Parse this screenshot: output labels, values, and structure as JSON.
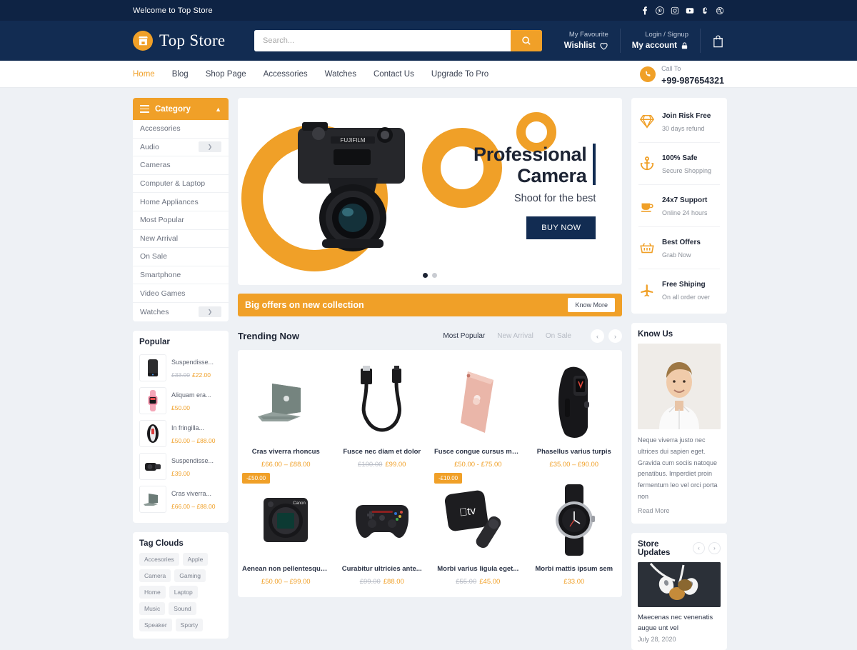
{
  "topbar": {
    "welcome": "Welcome to Top Store",
    "social": [
      {
        "name": "facebook-icon"
      },
      {
        "name": "pinterest-icon"
      },
      {
        "name": "instagram-icon"
      },
      {
        "name": "youtube-icon"
      },
      {
        "name": "stumbleupon-icon"
      },
      {
        "name": "dribbble-icon"
      }
    ]
  },
  "header": {
    "logo_text": "Top Store",
    "search_placeholder": "Search...",
    "search_value": "",
    "wishlist_top": "My Favourite",
    "wishlist_bottom": "Wishlist",
    "account_top": "Login / Signup",
    "account_bottom": "My account"
  },
  "nav": {
    "items": [
      {
        "label": "Home",
        "active": true
      },
      {
        "label": "Blog",
        "active": false
      },
      {
        "label": "Shop Page",
        "active": false
      },
      {
        "label": "Accessories",
        "active": false
      },
      {
        "label": "Watches",
        "active": false
      },
      {
        "label": "Contact Us",
        "active": false
      },
      {
        "label": "Upgrade To Pro",
        "active": false
      }
    ],
    "call_label": "Call To",
    "call_number": "+99-987654321"
  },
  "category": {
    "title": "Category",
    "items": [
      {
        "label": "Accessories",
        "sub": false
      },
      {
        "label": "Audio",
        "sub": true
      },
      {
        "label": "Cameras",
        "sub": false
      },
      {
        "label": "Computer & Laptop",
        "sub": false
      },
      {
        "label": "Home Appliances",
        "sub": false
      },
      {
        "label": "Most Popular",
        "sub": false
      },
      {
        "label": "New Arrival",
        "sub": false
      },
      {
        "label": "On Sale",
        "sub": false
      },
      {
        "label": "Smartphone",
        "sub": false
      },
      {
        "label": "Video Games",
        "sub": false
      },
      {
        "label": "Watches",
        "sub": true
      }
    ]
  },
  "popular": {
    "title": "Popular",
    "items": [
      {
        "name": "Suspendisse...",
        "old_price": "£33.00",
        "price": "£22.00",
        "thumb": "speaker"
      },
      {
        "name": "Aliquam era...",
        "old_price": "",
        "price": "£50.00",
        "thumb": "pink-watch"
      },
      {
        "name": "In fringilla...",
        "old_price": "",
        "price": "£50.00 – £88.00",
        "thumb": "band"
      },
      {
        "name": "Suspendisse...",
        "old_price": "",
        "price": "£39.00",
        "thumb": "camera-lens"
      },
      {
        "name": "Cras viverra...",
        "old_price": "",
        "price": "£66.00 – £88.00",
        "thumb": "laptop"
      }
    ]
  },
  "tagclouds": {
    "title": "Tag Clouds",
    "tags": [
      "Accesories",
      "Apple",
      "Camera",
      "Gaming",
      "Home",
      "Laptop",
      "Music",
      "Sound",
      "Speaker",
      "Sporty"
    ]
  },
  "hero": {
    "title_line1": "Professional",
    "title_line2": "Camera",
    "subtitle": "Shoot for the best",
    "cta": "BUY NOW",
    "brand_on_camera": "FUJIFILM",
    "slides": 2,
    "active_slide": 1
  },
  "offers": {
    "text": "Big offers on new collection",
    "button": "Know More"
  },
  "trending": {
    "title": "Trending Now",
    "tabs": [
      {
        "label": "Most Popular",
        "active": true
      },
      {
        "label": "New Arrival",
        "active": false
      },
      {
        "label": "On Sale",
        "active": false
      }
    ],
    "prev": "‹",
    "next": "›",
    "products": [
      {
        "name": "Cras viverra rhoncus",
        "old_price": "",
        "price": "£66.00 – £88.00",
        "badge": "",
        "img": "laptop"
      },
      {
        "name": "Fusce nec diam et dolor",
        "old_price": "£100.00",
        "price": "£99.00",
        "badge": "",
        "img": "cable"
      },
      {
        "name": "Fusce congue cursus metus",
        "old_price": "",
        "price": "£50.00 - £75.00",
        "badge": "",
        "img": "tablet"
      },
      {
        "name": "Phasellus varius turpis",
        "old_price": "",
        "price": "£35.00 – £90.00",
        "badge": "",
        "img": "fitband"
      },
      {
        "name": "Aenean non pellentesque...",
        "old_price": "",
        "price": "£50.00 – £99.00",
        "badge": "-£50.00",
        "img": "dslr"
      },
      {
        "name": "Curabitur ultricies ante...",
        "old_price": "£99.00",
        "price": "£88.00",
        "badge": "",
        "img": "gamepad"
      },
      {
        "name": "Morbi varius ligula eget...",
        "old_price": "£55.00",
        "price": "£45.00",
        "badge": "-£10.00",
        "img": "appletv"
      },
      {
        "name": "Morbi mattis ipsum sem",
        "old_price": "",
        "price": "£33.00",
        "badge": "",
        "img": "watch"
      }
    ]
  },
  "features": [
    {
      "icon": "diamond-icon",
      "title": "Join Risk Free",
      "sub": "30 days refund"
    },
    {
      "icon": "anchor-icon",
      "title": "100% Safe",
      "sub": "Secure Shopping"
    },
    {
      "icon": "cup-icon",
      "title": "24x7 Support",
      "sub": "Online 24 hours"
    },
    {
      "icon": "basket-icon",
      "title": "Best Offers",
      "sub": "Grab Now"
    },
    {
      "icon": "plane-icon",
      "title": "Free Shiping",
      "sub": "On all order over"
    }
  ],
  "knowus": {
    "title": "Know Us",
    "text": "Neque viverra justo nec ultrices dui sapien eget. Gravida cum sociis natoque penatibus. Imperdiet proin fermentum leo vel orci porta non",
    "read_more": "Read More"
  },
  "store_updates": {
    "title": "Store Updates",
    "prev": "‹",
    "next": "›",
    "post_title": "Maecenas nec venenatis augue unt vel",
    "post_date": "July 28, 2020"
  },
  "colors": {
    "accent": "#f0a028",
    "navy": "#122c52",
    "dark_navy": "#0e2344",
    "page_bg": "#eef1f5"
  }
}
